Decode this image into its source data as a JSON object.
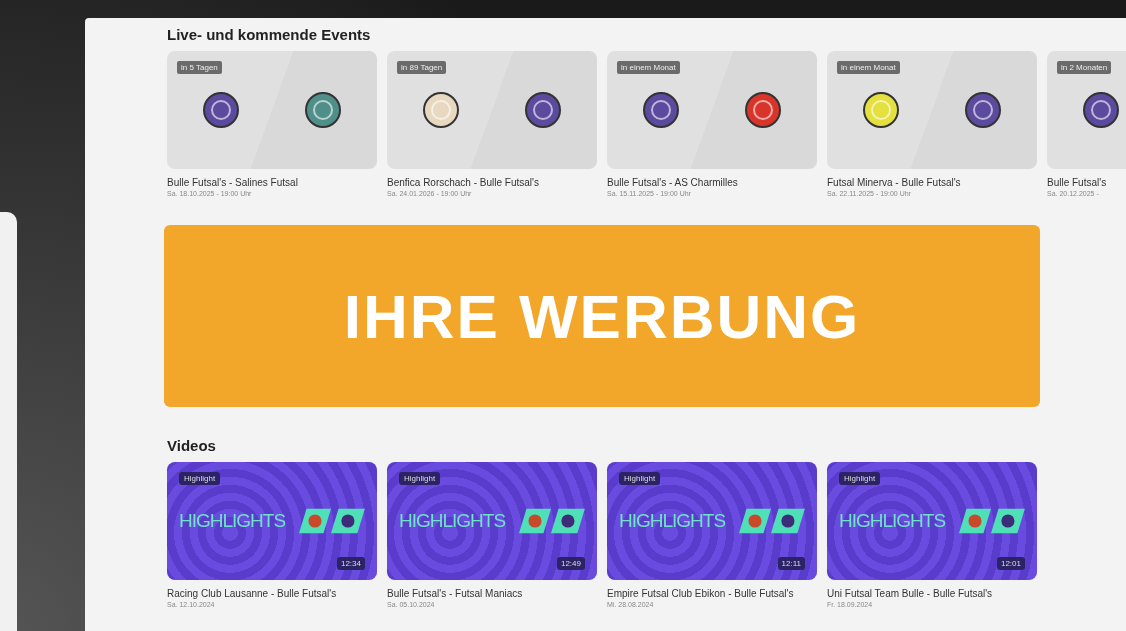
{
  "events": {
    "title": "Live- und kommende Events",
    "items": [
      {
        "badge": "in 5 Tagen",
        "teams": [
          {
            "color": "#5b4a9e"
          },
          {
            "color": "#4f8f8a"
          }
        ],
        "title": "Bulle Futsal's - Salines Futsal",
        "date": "Sa. 18.10.2025 - 19:00 Uhr"
      },
      {
        "badge": "in 89 Tagen",
        "teams": [
          {
            "color": "#e8d8c0"
          },
          {
            "color": "#5b4a9e"
          }
        ],
        "title": "Benfica Rorschach - Bulle Futsal's",
        "date": "Sa. 24.01.2026 - 19:00 Uhr"
      },
      {
        "badge": "in einem Monat",
        "teams": [
          {
            "color": "#5b4a9e"
          },
          {
            "color": "#d8342a"
          }
        ],
        "title": "Bulle Futsal's - AS Charmilles",
        "date": "Sa. 15.11.2025 - 19:00 Uhr"
      },
      {
        "badge": "in einem Monat",
        "teams": [
          {
            "color": "#e3e040"
          },
          {
            "color": "#5b4a9e"
          }
        ],
        "title": "Futsal Minerva - Bulle Futsal's",
        "date": "Sa. 22.11.2025 - 19:00 Uhr"
      },
      {
        "badge": "in 2 Monaten",
        "teams": [
          {
            "color": "#5b4a9e"
          }
        ],
        "title": "Bulle Futsal's",
        "date": "Sa. 20.12.2025 -"
      }
    ]
  },
  "ad": {
    "text": "IHRE WERBUNG"
  },
  "videos": {
    "title": "Videos",
    "items": [
      {
        "tag": "Highlight",
        "headline": "HIGHLIGHTS",
        "duration": "12:34",
        "title": "Racing Club Lausanne - Bulle Futsal's",
        "date": "Sa. 12.10.2024"
      },
      {
        "tag": "Highlight",
        "headline": "HIGHLIGHTS",
        "duration": "12:49",
        "title": "Bulle Futsal's - Futsal Maniacs",
        "date": "Sa. 05.10.2024"
      },
      {
        "tag": "Highlight",
        "headline": "HIGHLIGHTS",
        "duration": "12:11",
        "title": "Empire Futsal Club Ebikon - Bulle Futsal's",
        "date": "Mi. 28.08.2024"
      },
      {
        "tag": "Highlight",
        "headline": "HIGHLIGHTS",
        "duration": "12:01",
        "title": "Uni Futsal Team Bulle - Bulle Futsal's",
        "date": "Fr. 18.09.2024"
      }
    ]
  }
}
